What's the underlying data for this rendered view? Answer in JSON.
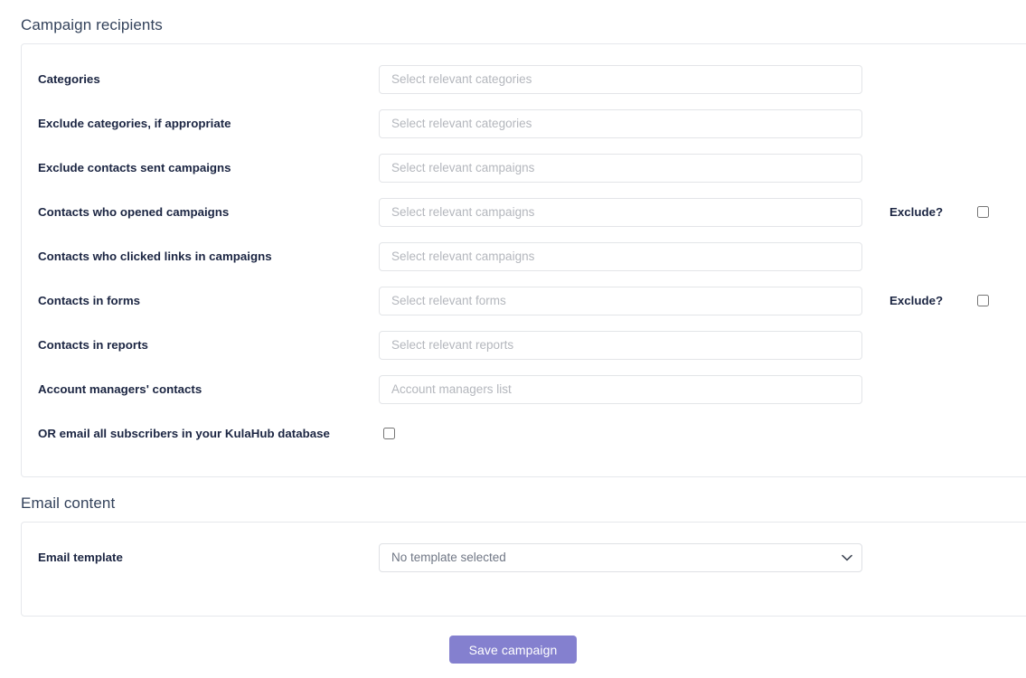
{
  "recipients": {
    "heading": "Campaign recipients",
    "rows": [
      {
        "label": "Categories",
        "placeholder": "Select relevant categories",
        "control": "text",
        "exclude": null
      },
      {
        "label": "Exclude categories, if appropriate",
        "placeholder": "Select relevant categories",
        "control": "text",
        "exclude": null
      },
      {
        "label": "Exclude contacts sent campaigns",
        "placeholder": "Select relevant campaigns",
        "control": "text",
        "exclude": null
      },
      {
        "label": "Contacts who opened campaigns",
        "placeholder": "Select relevant campaigns",
        "control": "text",
        "exclude": "Exclude?"
      },
      {
        "label": "Contacts who clicked links in campaigns",
        "placeholder": "Select relevant campaigns",
        "control": "text",
        "exclude": null
      },
      {
        "label": "Contacts in forms",
        "placeholder": "Select relevant forms",
        "control": "text",
        "exclude": "Exclude?"
      },
      {
        "label": "Contacts in reports",
        "placeholder": "Select relevant reports",
        "control": "text",
        "exclude": null
      },
      {
        "label": "Account managers' contacts",
        "placeholder": "Account managers list",
        "control": "text",
        "exclude": null
      },
      {
        "label": "OR email all subscribers in your KulaHub database",
        "placeholder": "",
        "control": "checkbox",
        "exclude": null
      }
    ]
  },
  "email_content": {
    "heading": "Email content",
    "template_label": "Email template",
    "template_value": "No template selected",
    "template_options": [
      "No template selected"
    ],
    "chevron_icon": "chevron-down-icon"
  },
  "footer": {
    "save_label": "Save campaign"
  },
  "colors": {
    "accent": "#8480cf",
    "label_text": "#1b2542",
    "heading_text": "#33425b",
    "placeholder": "#b4b7bd",
    "card_border": "#e6e8ec",
    "input_border": "#e3e5e8"
  }
}
